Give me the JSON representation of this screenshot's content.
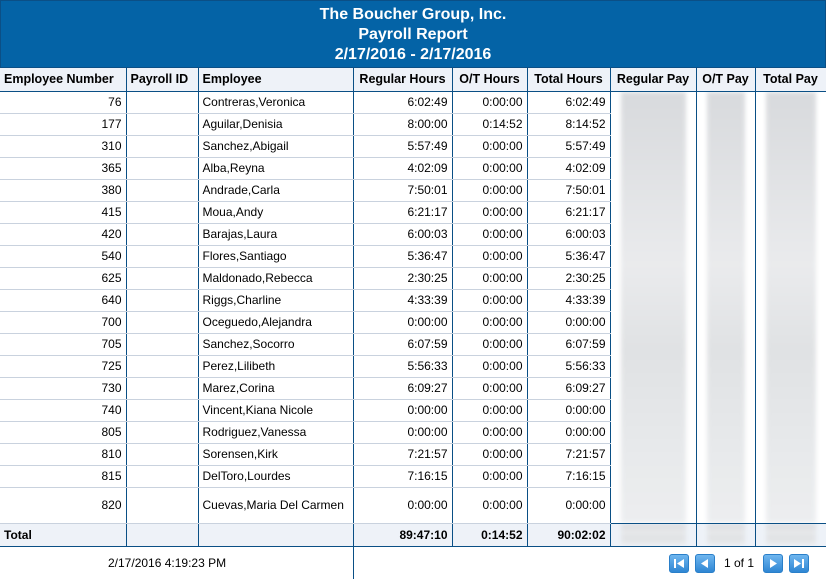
{
  "header": {
    "company": "The Boucher Group, Inc.",
    "report_title": "Payroll Report",
    "date_range": "2/17/2016 - 2/17/2016"
  },
  "columns": [
    "Employee Number",
    "Payroll ID",
    "Employee",
    "Regular Hours",
    "O/T Hours",
    "Total Hours",
    "Regular Pay",
    "O/T Pay",
    "Total Pay"
  ],
  "rows": [
    {
      "num": "76",
      "payroll_id": "",
      "name": "Contreras,Veronica",
      "reg": "6:02:49",
      "ot": "0:00:00",
      "total": "6:02:49"
    },
    {
      "num": "177",
      "payroll_id": "",
      "name": "Aguilar,Denisia",
      "reg": "8:00:00",
      "ot": "0:14:52",
      "total": "8:14:52"
    },
    {
      "num": "310",
      "payroll_id": "",
      "name": "Sanchez,Abigail",
      "reg": "5:57:49",
      "ot": "0:00:00",
      "total": "5:57:49"
    },
    {
      "num": "365",
      "payroll_id": "",
      "name": "Alba,Reyna",
      "reg": "4:02:09",
      "ot": "0:00:00",
      "total": "4:02:09"
    },
    {
      "num": "380",
      "payroll_id": "",
      "name": "Andrade,Carla",
      "reg": "7:50:01",
      "ot": "0:00:00",
      "total": "7:50:01"
    },
    {
      "num": "415",
      "payroll_id": "",
      "name": "Moua,Andy",
      "reg": "6:21:17",
      "ot": "0:00:00",
      "total": "6:21:17"
    },
    {
      "num": "420",
      "payroll_id": "",
      "name": "Barajas,Laura",
      "reg": "6:00:03",
      "ot": "0:00:00",
      "total": "6:00:03"
    },
    {
      "num": "540",
      "payroll_id": "",
      "name": "Flores,Santiago",
      "reg": "5:36:47",
      "ot": "0:00:00",
      "total": "5:36:47"
    },
    {
      "num": "625",
      "payroll_id": "",
      "name": "Maldonado,Rebecca",
      "reg": "2:30:25",
      "ot": "0:00:00",
      "total": "2:30:25"
    },
    {
      "num": "640",
      "payroll_id": "",
      "name": "Riggs,Charline",
      "reg": "4:33:39",
      "ot": "0:00:00",
      "total": "4:33:39"
    },
    {
      "num": "700",
      "payroll_id": "",
      "name": "Oceguedo,Alejandra",
      "reg": "0:00:00",
      "ot": "0:00:00",
      "total": "0:00:00"
    },
    {
      "num": "705",
      "payroll_id": "",
      "name": "Sanchez,Socorro",
      "reg": "6:07:59",
      "ot": "0:00:00",
      "total": "6:07:59"
    },
    {
      "num": "725",
      "payroll_id": "",
      "name": "Perez,Lilibeth",
      "reg": "5:56:33",
      "ot": "0:00:00",
      "total": "5:56:33"
    },
    {
      "num": "730",
      "payroll_id": "",
      "name": "Marez,Corina",
      "reg": "6:09:27",
      "ot": "0:00:00",
      "total": "6:09:27"
    },
    {
      "num": "740",
      "payroll_id": "",
      "name": "Vincent,Kiana Nicole",
      "reg": "0:00:00",
      "ot": "0:00:00",
      "total": "0:00:00"
    },
    {
      "num": "805",
      "payroll_id": "",
      "name": "Rodriguez,Vanessa",
      "reg": "0:00:00",
      "ot": "0:00:00",
      "total": "0:00:00"
    },
    {
      "num": "810",
      "payroll_id": "",
      "name": "Sorensen,Kirk",
      "reg": "7:21:57",
      "ot": "0:00:00",
      "total": "7:21:57"
    },
    {
      "num": "815",
      "payroll_id": "",
      "name": "DelToro,Lourdes",
      "reg": "7:16:15",
      "ot": "0:00:00",
      "total": "7:16:15"
    },
    {
      "num": "820",
      "payroll_id": "",
      "name": "Cuevas,Maria Del Carmen",
      "reg": "0:00:00",
      "ot": "0:00:00",
      "total": "0:00:00"
    }
  ],
  "totals": {
    "label": "Total",
    "reg": "89:47:10",
    "ot": "0:14:52",
    "total": "90:02:02"
  },
  "footer": {
    "timestamp": "2/17/2016 4:19:23 PM",
    "page_info": "1 of 1"
  },
  "colors": {
    "header_bg": "#0463a6",
    "grid_line": "#0a4f85",
    "pager_button": "#2f86d3"
  },
  "icons": [
    "first-page-icon",
    "previous-page-icon",
    "next-page-icon",
    "last-page-icon"
  ]
}
